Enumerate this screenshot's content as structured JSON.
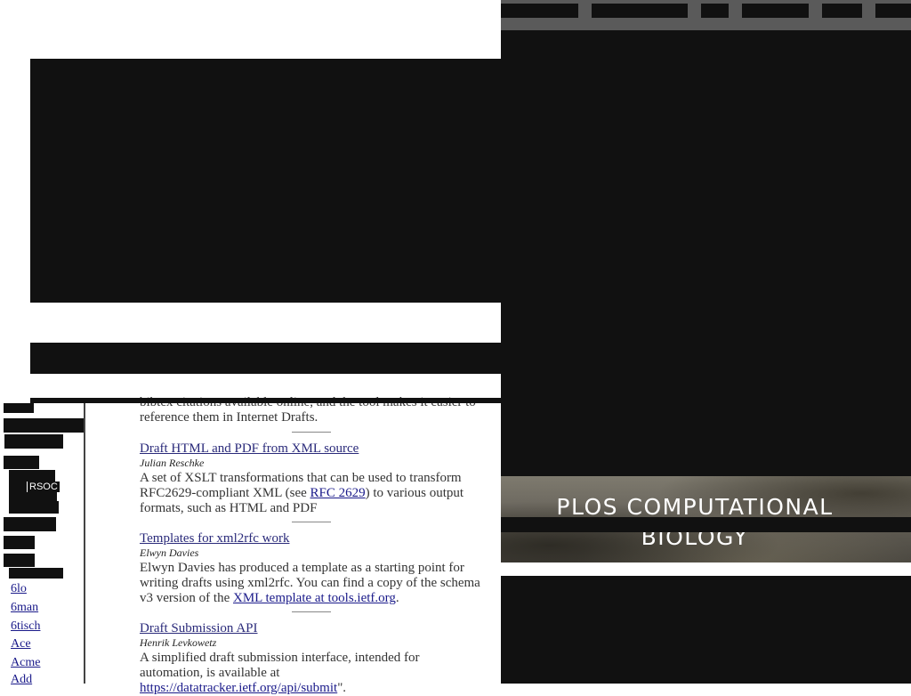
{
  "intro_fragment": {
    "line1": "bibtex citations available online, and the tool makes it easier to",
    "line2": "reference them in Internet Drafts."
  },
  "sidebar": {
    "rsoc_label": "RSOC",
    "wg_links": [
      "6lo",
      "6man",
      "6tisch",
      "Ace",
      "Acme",
      "Add"
    ]
  },
  "tools": [
    {
      "title": "Draft HTML and PDF from XML source",
      "author": "Julian Reschke",
      "desc_a": "A set of XSLT transformations that can be used to transform RFC2629-compliant XML (see ",
      "link": "RFC 2629",
      "desc_b": ") to various output formats, such as HTML and PDF"
    },
    {
      "title": "Templates for xml2rfc work",
      "author": "Elwyn Davies",
      "desc_a": "Elwyn Davies has produced a template as a starting point for writing drafts using xml2rfc. You can find a copy of the schema v3 version of the ",
      "link": "XML template at tools.ietf.org",
      "desc_b": "."
    },
    {
      "title": "Draft Submission API",
      "author": "Henrik Levkowetz",
      "desc_a": "A simplified draft submission interface, intended for automation, is available at ",
      "link": "https://datatracker.ietf.org/api/submit",
      "desc_b": "\"."
    }
  ],
  "banner": {
    "title_line1": "PLOS COMPUTATIONAL",
    "title_line2": "BIOLOGY"
  },
  "colors": {
    "overlay": "#111111",
    "nav_bar": "#5a5a5a",
    "link": "#1a1a8a"
  }
}
